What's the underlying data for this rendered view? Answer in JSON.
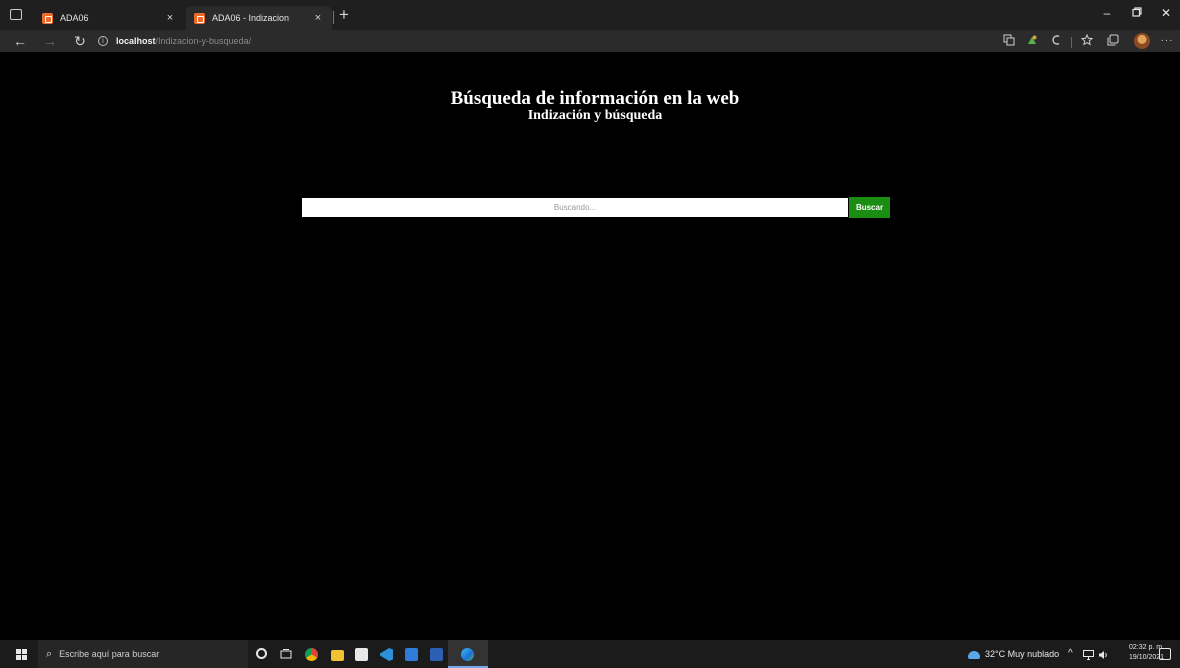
{
  "browser": {
    "tabs": [
      {
        "label": "ADA06",
        "close": "×"
      },
      {
        "label": "ADA06 - Indizacion",
        "close": "×"
      }
    ],
    "new_tab": "+",
    "window_controls": {
      "minimize": "–",
      "maximize": "▫",
      "close": "✕"
    },
    "nav": {
      "back": "←",
      "forward": "→",
      "reload": "↻"
    },
    "address": {
      "host": "localhost",
      "path": "/Indizacion-y-busqueda/"
    },
    "toolbar_icons": [
      "translate-icon",
      "extension-icon",
      "reading-list-icon",
      "favorites-icon",
      "collections-icon",
      "profile-avatar",
      "more-icon"
    ]
  },
  "page": {
    "title": "Búsqueda de información en la web",
    "subtitle": "Indización y búsqueda",
    "search": {
      "placeholder": "Buscando...",
      "button_label": "Buscar"
    },
    "colors": {
      "background": "#000000",
      "button": "#1c8d13"
    }
  },
  "taskbar": {
    "search_placeholder": "Escribe aquí para buscar",
    "apps": [
      "cortana-icon",
      "task-view-icon",
      "chrome-icon",
      "file-explorer-icon",
      "store-icon",
      "vscode-icon",
      "mail-icon",
      "word-icon",
      "edge-icon"
    ],
    "weather": "32°C  Muy nublado",
    "clock_time": "02:32 p. m.",
    "clock_date": "19/10/2021"
  }
}
